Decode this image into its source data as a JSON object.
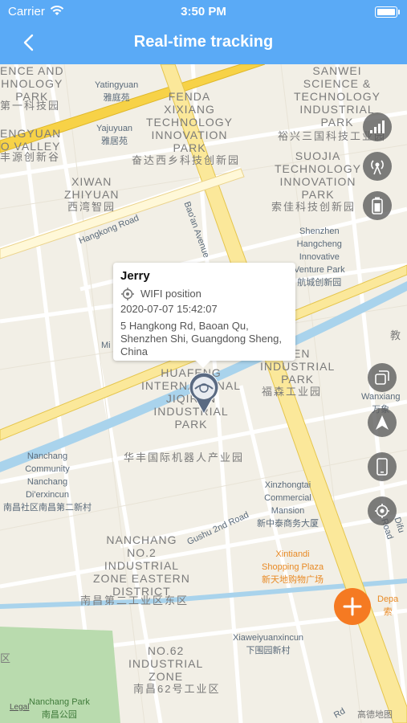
{
  "status_bar": {
    "carrier": "Carrier",
    "time": "3:50 PM"
  },
  "header": {
    "title": "Real-time tracking"
  },
  "map": {
    "labels": [
      {
        "text": "ENCE AND\nHNOLOGY\nPARK",
        "style": ""
      },
      {
        "text": "第一科技园",
        "style": "cn"
      },
      {
        "text": "Yatingyuan\n雅庭苑",
        "style": "small"
      },
      {
        "text": "Yajuyuan\n雅居苑",
        "style": "small"
      },
      {
        "text": "ENGYUAN\nO VALLEY",
        "style": ""
      },
      {
        "text": "丰源创新谷",
        "style": "cn"
      },
      {
        "text": "FENDA\nXIXIANG\nTECHNOLOGY\nINNOVATION\nPARK",
        "style": ""
      },
      {
        "text": "奋达西乡科技创新园",
        "style": "cn"
      },
      {
        "text": "SANWEI\nSCIENCE &\nTECHNOLOGY\nINDUSTRIAL\nPARK",
        "style": ""
      },
      {
        "text": "裕兴三国科技工业园",
        "style": "cn"
      },
      {
        "text": "XIWAN\nZHIYUAN",
        "style": ""
      },
      {
        "text": "西湾智园",
        "style": "cn"
      },
      {
        "text": "SUOJIA\nTECHNOLOGY\nINNOVATION\nPARK",
        "style": ""
      },
      {
        "text": "索佳科技创新园",
        "style": "cn"
      },
      {
        "text": "Hangkong Road",
        "style": "small"
      },
      {
        "text": "Bao'an Avenue",
        "style": "small"
      },
      {
        "text": "Shenzhen\nHangcheng\nInnovative\nVenture Park\n航城创新园",
        "style": "small"
      },
      {
        "text": "SEN\nINDUSTRIAL\nPARK",
        "style": ""
      },
      {
        "text": "福森工业园",
        "style": "cn"
      },
      {
        "text": "Wanxiang\n万象",
        "style": "small"
      },
      {
        "text": "HUAFENG\nINTERNATIONAL\nJIQIREN\nINDUSTRIAL\nPARK",
        "style": ""
      },
      {
        "text": "华丰国际机器人产业园",
        "style": "cn"
      },
      {
        "text": "Nanchang\nCommunity\nNanchang\nDi'erxincun\n南昌社区南昌第二新村",
        "style": "small"
      },
      {
        "text": "Xinzhongtai\nCommercial\nMansion\n新中泰商务大厦",
        "style": "small"
      },
      {
        "text": "NANCHANG\nNO.2\nINDUSTRIAL\nZONE EASTERN\nDISTRICT",
        "style": ""
      },
      {
        "text": "南昌第二工业区东区",
        "style": "cn"
      },
      {
        "text": "Gushu 2nd Road",
        "style": "small"
      },
      {
        "text": "Xintiandi\nShopping Plaza\n新天地购物广场",
        "style": "small"
      },
      {
        "text": "Xiaweiyuanxincun\n下围园新村",
        "style": "small"
      },
      {
        "text": "NO.62\nINDUSTRIAL\nZONE",
        "style": ""
      },
      {
        "text": "南昌62号工业区",
        "style": "cn"
      },
      {
        "text": "Nanchang Park\n南昌公园",
        "style": "small"
      },
      {
        "text": "Difu Road",
        "style": "small"
      },
      {
        "text": "Depa\n索",
        "style": "small"
      },
      {
        "text": "教",
        "style": "cn"
      },
      {
        "text": "Mi",
        "style": "small"
      },
      {
        "text": "区",
        "style": "cn"
      },
      {
        "text": "Rd",
        "style": "small"
      }
    ],
    "legal": "Legal",
    "provider": "高德地图"
  },
  "popup": {
    "name": "Jerry",
    "position_type": "WIFI position",
    "timestamp": "2020-07-07 15:42:07",
    "address": "5 Hangkong Rd, Baoan Qu, Shenzhen Shi, Guangdong Sheng, China"
  },
  "marker": {
    "device_name": "Jerry",
    "brand_color": "#5a6a82"
  },
  "controls": {
    "top": [
      "signal-icon",
      "tower-icon",
      "battery-icon"
    ],
    "bottom": [
      "map-layers-icon",
      "navigate-icon",
      "phone-icon",
      "locate-icon"
    ],
    "fab_icon": "plus-icon",
    "fab_color": "#f57a22"
  },
  "colors": {
    "header": "#5aaaf6",
    "road_yellow": "#f7d247",
    "water": "#a9d3ec",
    "park": "#b9dbae"
  }
}
